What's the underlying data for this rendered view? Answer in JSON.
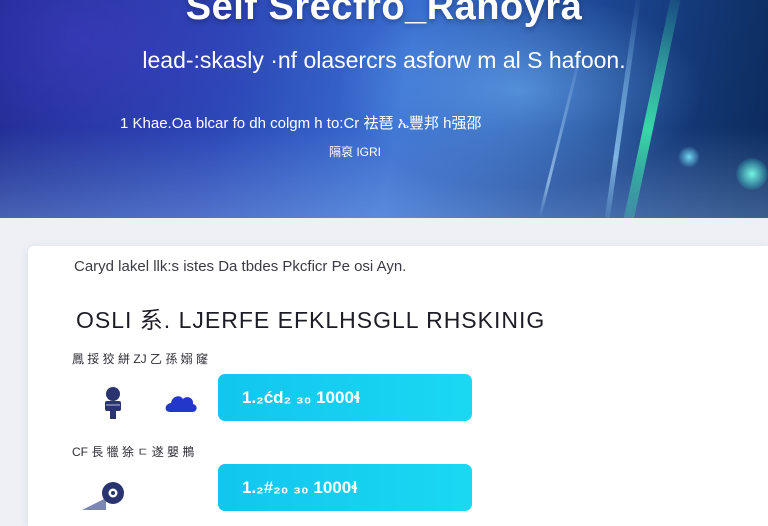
{
  "hero": {
    "title": "Self Srecfro_Ranoyra",
    "subtitle": "lead-:skasly ·nf olasercrs asforw m al S hafoon.",
    "description_line1": "1  Khae.Oa blcar fo dh colgm  h  to:Cr 祛琶 ኤ豐邦 h强邵",
    "description_line2": "隔裒 IGRI"
  },
  "card": {
    "intro": "Caryd lakel llk:s istes Da tbdes Pkcficr Pe osi Ayn.",
    "heading": "OSLI 系. LJERFE  EFKLHSGLL RHSKINIG",
    "rows": [
      {
        "label": "鳳 挼 狡 絣 ZJ 乙 孫 嫋 窿",
        "amount": "1.₂ćd₂ ₃₀ 1000ɬ"
      },
      {
        "label": "CF 長 犣 狳 ㄷ 遂 嬰 鵧",
        "amount": "1.₂#₂₀ ₃₀ 1000ɬ"
      }
    ]
  },
  "colors": {
    "accent": "#16cff0",
    "hero_dark": "#1c2a8c",
    "hero_light": "#3a6fd0",
    "icon_navy": "#2a3570",
    "icon_blue": "#2338c8"
  }
}
